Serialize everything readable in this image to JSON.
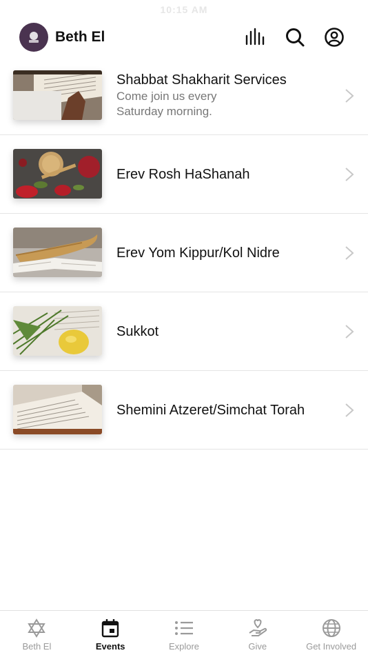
{
  "status": {
    "time": "10:15 AM"
  },
  "header": {
    "title": "Beth El"
  },
  "events": [
    {
      "title": "Shabbat Shakharit Services",
      "subtitle": "Come join us every Saturday morning."
    },
    {
      "title": "Erev Rosh HaShanah",
      "subtitle": ""
    },
    {
      "title": "Erev Yom Kippur/Kol Nidre",
      "subtitle": ""
    },
    {
      "title": "Sukkot",
      "subtitle": ""
    },
    {
      "title": "Shemini Atzeret/Simchat Torah",
      "subtitle": ""
    }
  ],
  "tabs": [
    {
      "label": "Beth El",
      "icon": "star-of-david-icon",
      "active": false
    },
    {
      "label": "Events",
      "icon": "calendar-icon",
      "active": true
    },
    {
      "label": "Explore",
      "icon": "list-icon",
      "active": false
    },
    {
      "label": "Give",
      "icon": "hand-heart-icon",
      "active": false
    },
    {
      "label": "Get Involved",
      "icon": "globe-icon",
      "active": false
    }
  ],
  "colors": {
    "avatar_bg": "#4a3350",
    "inactive": "#9a9a9a",
    "active": "#111111"
  }
}
